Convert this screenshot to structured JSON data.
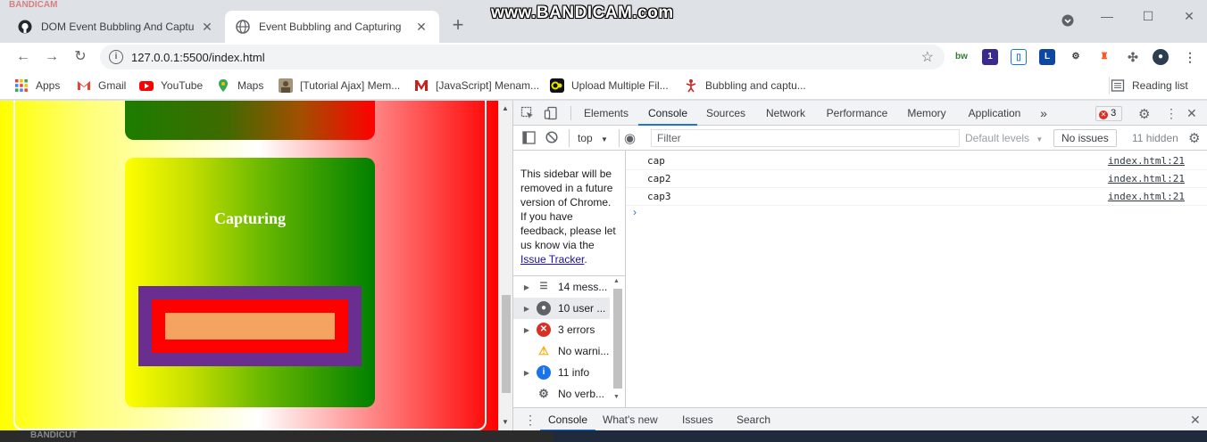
{
  "browser": {
    "tabs": [
      {
        "title": "DOM Event Bubbling And Captur",
        "active": false
      },
      {
        "title": "Event Bubbling and Capturing",
        "active": true
      }
    ],
    "new_tab_label": "+",
    "url": "127.0.0.1:5500/index.html",
    "watermark": "www.BANDICAM.com"
  },
  "bookmarks": {
    "items": [
      {
        "label": "Apps",
        "icon": "apps-grid-icon"
      },
      {
        "label": "Gmail",
        "icon": "gmail-icon"
      },
      {
        "label": "YouTube",
        "icon": "youtube-icon"
      },
      {
        "label": "Maps",
        "icon": "maps-icon"
      },
      {
        "label": "[Tutorial Ajax] Mem...",
        "icon": "avatar-icon"
      },
      {
        "label": "[JavaScript] Menam...",
        "icon": "medium-icon"
      },
      {
        "label": "Upload Multiple Fil...",
        "icon": "cb-icon"
      },
      {
        "label": "Bubbling and captu...",
        "icon": "figure-icon"
      }
    ],
    "reading_list": "Reading list"
  },
  "page": {
    "capturing_title": "Capturing"
  },
  "devtools": {
    "tabs": [
      "Elements",
      "Console",
      "Sources",
      "Network",
      "Performance",
      "Memory",
      "Application"
    ],
    "active_tab": "Console",
    "more_tabs": "»",
    "error_count": "3",
    "context": "top",
    "filter_placeholder": "Filter",
    "default_levels": "Default levels",
    "no_issues": "No issues",
    "hidden_count": "11 hidden",
    "sidebar_note": "This sidebar will be removed in a future version of Chrome. If you have feedback, please let us know via the",
    "sidebar_link": "Issue Tracker",
    "sidebar_items": [
      {
        "label": "14 mess...",
        "icon": "list-icon",
        "expandable": true
      },
      {
        "label": "10 user ...",
        "icon": "user-icon",
        "expandable": true
      },
      {
        "label": "3 errors",
        "icon": "error-icon",
        "expandable": true
      },
      {
        "label": "No warni...",
        "icon": "warning-icon",
        "expandable": false
      },
      {
        "label": "11 info",
        "icon": "info-icon",
        "expandable": true
      },
      {
        "label": "No verb...",
        "icon": "gear-icon",
        "expandable": false
      }
    ],
    "console_rows": [
      {
        "message": "cap",
        "source": "index.html:21"
      },
      {
        "message": "cap2",
        "source": "index.html:21"
      },
      {
        "message": "cap3",
        "source": "index.html:21"
      }
    ],
    "drawer_tabs": [
      "Console",
      "What's new",
      "Issues",
      "Search"
    ],
    "drawer_active": "Console"
  },
  "colors": {
    "accent": "#1a73e8",
    "error": "#d93025",
    "purple": "#6a2e91",
    "salmon": "#f4a460"
  }
}
